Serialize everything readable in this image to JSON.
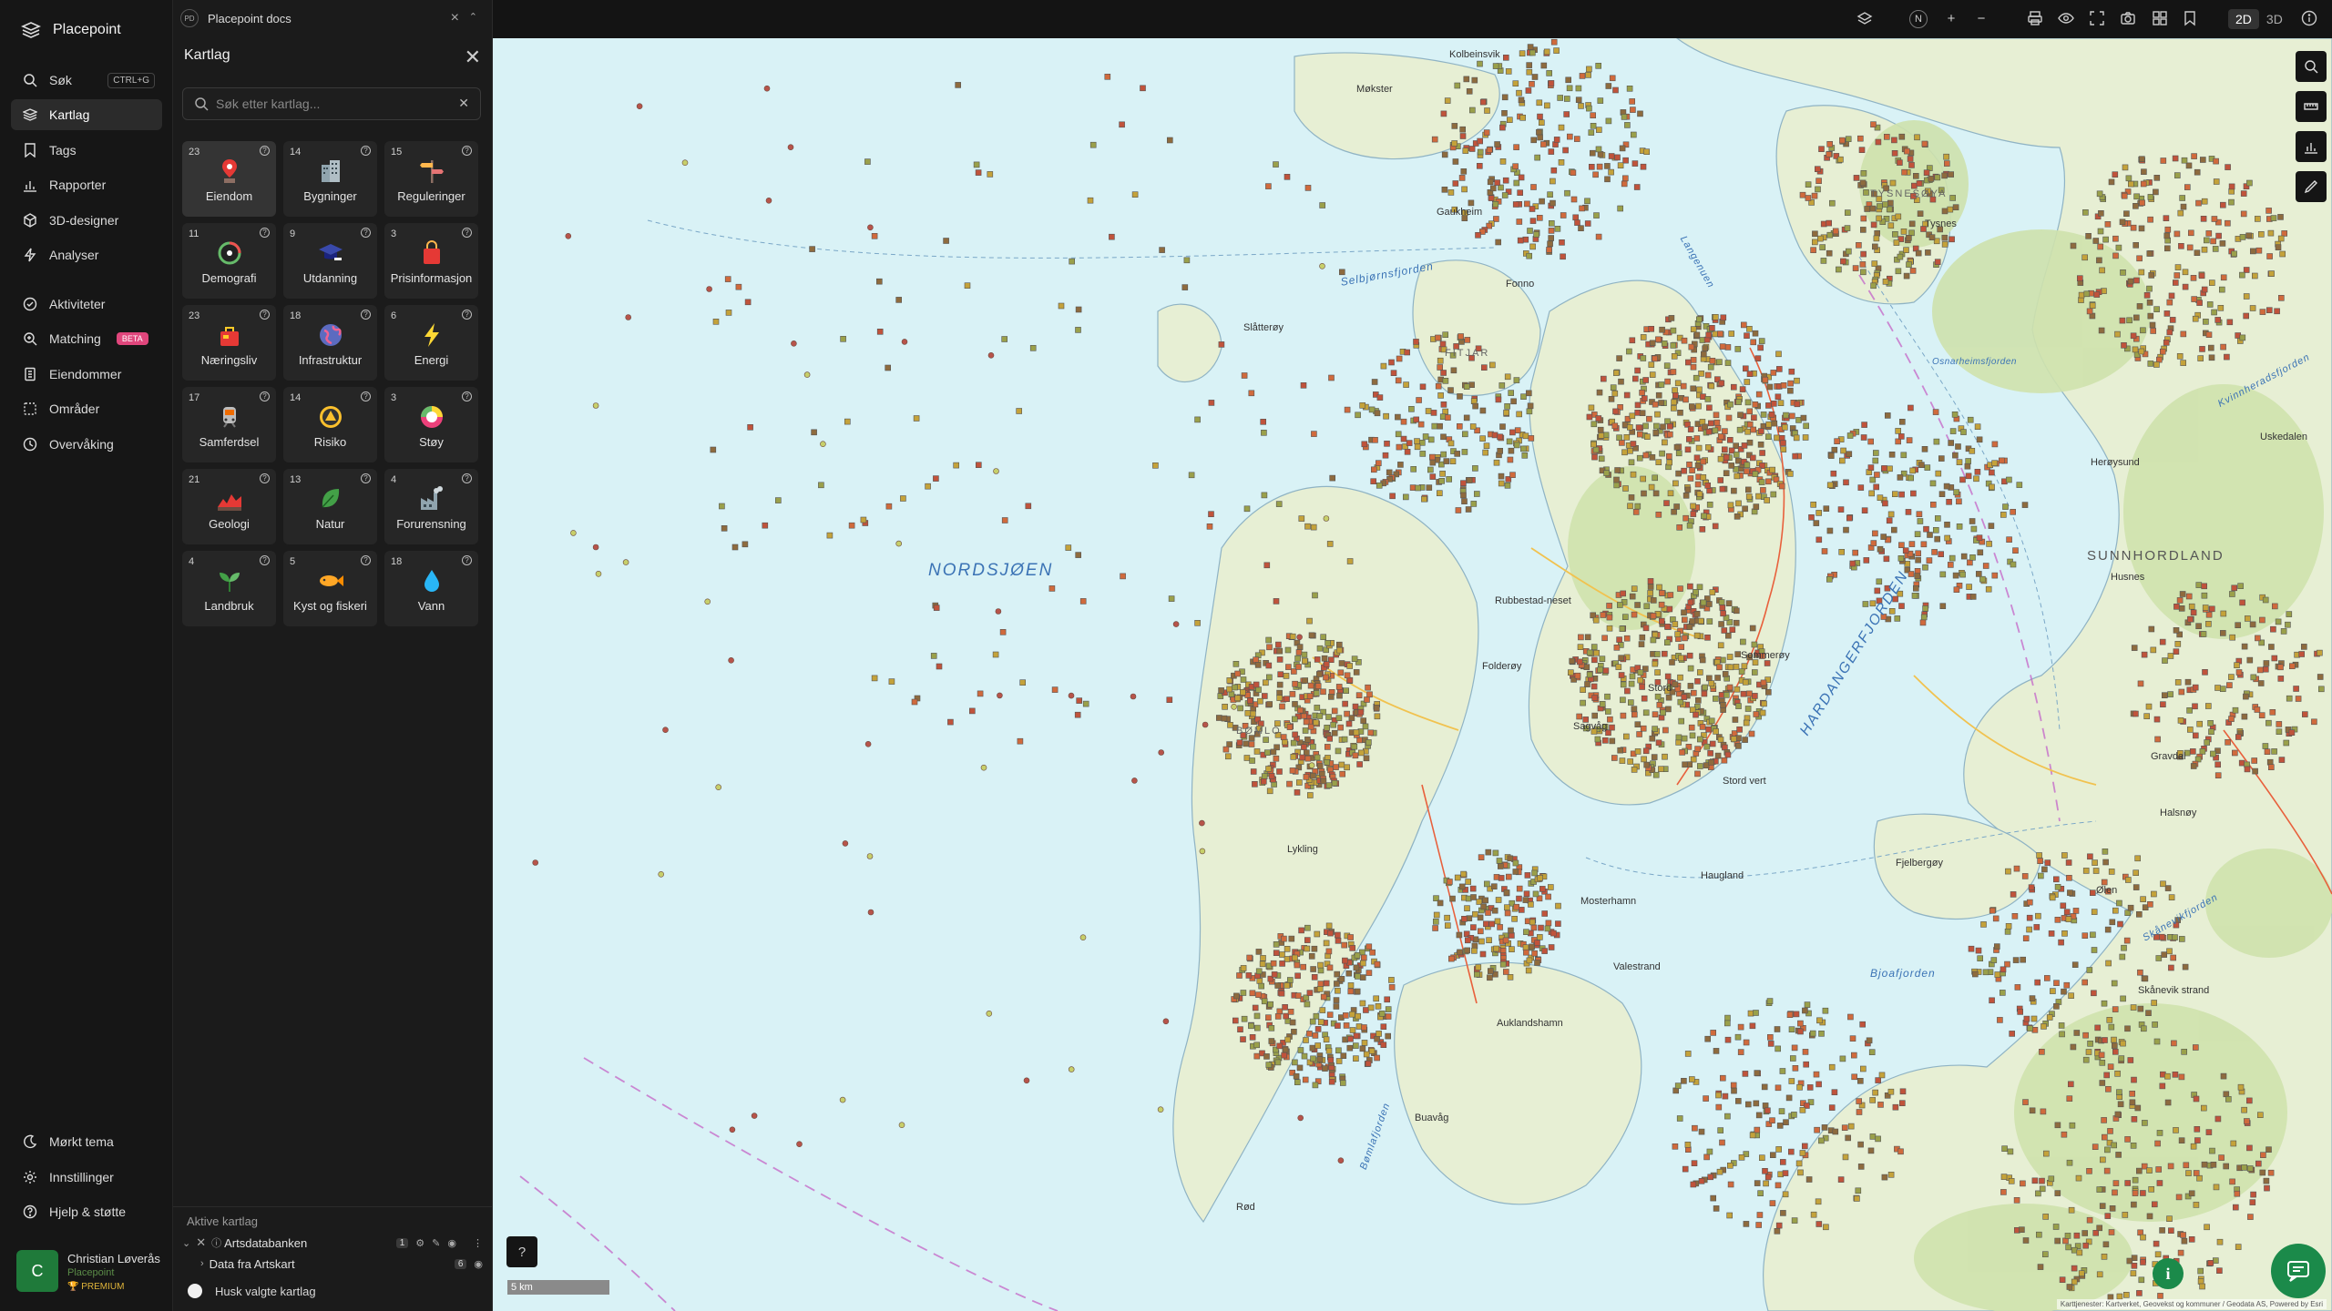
{
  "app": {
    "name": "Placepoint",
    "doc_tab": "Placepoint docs",
    "doc_badge": "PD"
  },
  "nav": {
    "items": [
      {
        "label": "Søk",
        "shortcut": "CTRL+G",
        "icon": "search-icon"
      },
      {
        "label": "Kartlag",
        "icon": "layers-icon",
        "active": true
      },
      {
        "label": "Tags",
        "icon": "bookmark-icon"
      },
      {
        "label": "Rapporter",
        "icon": "bar-chart-icon"
      },
      {
        "label": "3D-designer",
        "icon": "cube-icon"
      },
      {
        "label": "Analyser",
        "icon": "lightning-icon"
      },
      {
        "label": "Aktiviteter",
        "icon": "activity-icon"
      },
      {
        "label": "Matching",
        "badge": "BETA",
        "icon": "match-icon"
      },
      {
        "label": "Eiendommer",
        "icon": "building-icon"
      },
      {
        "label": "Områder",
        "icon": "area-icon"
      },
      {
        "label": "Overvåking",
        "icon": "monitor-icon"
      }
    ],
    "bottom": [
      {
        "label": "Mørkt tema",
        "icon": "moon-icon"
      },
      {
        "label": "Innstillinger",
        "icon": "gear-icon"
      },
      {
        "label": "Hjelp & støtte",
        "icon": "help-icon"
      }
    ]
  },
  "user": {
    "initial": "C",
    "name": "Christian Løverås",
    "org": "Placepoint",
    "plan": "PREMIUM"
  },
  "panel": {
    "title": "Kartlag",
    "search_placeholder": "Søk etter kartlag...",
    "tiles": [
      {
        "count": "23",
        "label": "Eiendom",
        "icon": "property-pin-icon"
      },
      {
        "count": "14",
        "label": "Bygninger",
        "icon": "buildings-icon"
      },
      {
        "count": "15",
        "label": "Reguleringer",
        "icon": "signpost-icon"
      },
      {
        "count": "11",
        "label": "Demografi",
        "icon": "demography-icon"
      },
      {
        "count": "9",
        "label": "Utdanning",
        "icon": "graduation-icon"
      },
      {
        "count": "3",
        "label": "Prisinformasjon",
        "icon": "shopping-bag-icon"
      },
      {
        "count": "23",
        "label": "Næringsliv",
        "icon": "business-bag-icon"
      },
      {
        "count": "18",
        "label": "Infrastruktur",
        "icon": "globe-icon"
      },
      {
        "count": "6",
        "label": "Energi",
        "icon": "lightning-bolt-icon"
      },
      {
        "count": "17",
        "label": "Samferdsel",
        "icon": "train-icon"
      },
      {
        "count": "14",
        "label": "Risiko",
        "icon": "hazard-icon"
      },
      {
        "count": "3",
        "label": "Støy",
        "icon": "noise-gauge-icon"
      },
      {
        "count": "21",
        "label": "Geologi",
        "icon": "terrain-icon"
      },
      {
        "count": "13",
        "label": "Natur",
        "icon": "leaf-icon"
      },
      {
        "count": "4",
        "label": "Forurensning",
        "icon": "factory-icon"
      },
      {
        "count": "4",
        "label": "Landbruk",
        "icon": "sprout-icon"
      },
      {
        "count": "5",
        "label": "Kyst og fiskeri",
        "icon": "fish-icon"
      },
      {
        "count": "18",
        "label": "Vann",
        "icon": "water-drop-icon"
      }
    ],
    "active_header": "Aktive kartlag",
    "active_layers": [
      {
        "label": "Artsdatabanken",
        "count": "1"
      },
      {
        "label": "Data fra Artskart",
        "count": "6"
      }
    ],
    "remember_label": "Husk valgte kartlag"
  },
  "topbar": {
    "mode_2d": "2D",
    "mode_3d": "3D",
    "active_mode": "2D",
    "compass": "N"
  },
  "map": {
    "sea_label": "NORDSJØEN",
    "region_label": "SUNNHORDLAND",
    "fjords": [
      "HARDANGERFJORDEN",
      "Selbjørnsfjorden",
      "Bjoafjorden",
      "Skånevikfjorden",
      "Bømlafjorden",
      "Kvinnheradsfjorden",
      "Osnarheimsfjorden",
      "Langenuen"
    ],
    "places": [
      "Kolbeinsvik",
      "Møkster",
      "Gaukheim",
      "Fonno",
      "Slåtterøy",
      "FITJAR",
      "TYSNESØYA",
      "Tysnes",
      "Rubbestad-neset",
      "Folderøy",
      "Sagvåg",
      "Stord",
      "Leirvik",
      "Stord vert",
      "Sommerøy",
      "Lykling",
      "Mosterhamn",
      "Valestrand",
      "Haugland",
      "Auklandshamn",
      "Buavåg",
      "Fjelbergøy",
      "Halsnøy",
      "Skånevik strand",
      "Gravdal",
      "Uskedalen",
      "Herøysund",
      "Husnes",
      "Ølen",
      "Rød",
      "BØMLO",
      "Fjelberg",
      "Valen",
      "Stord",
      "Svortland",
      "Sunde"
    ],
    "scale_label": "5 km",
    "attribution": "Karttjenester: Kartverket, Geovekst og kommuner / Geodata AS, Powered by Esri"
  }
}
